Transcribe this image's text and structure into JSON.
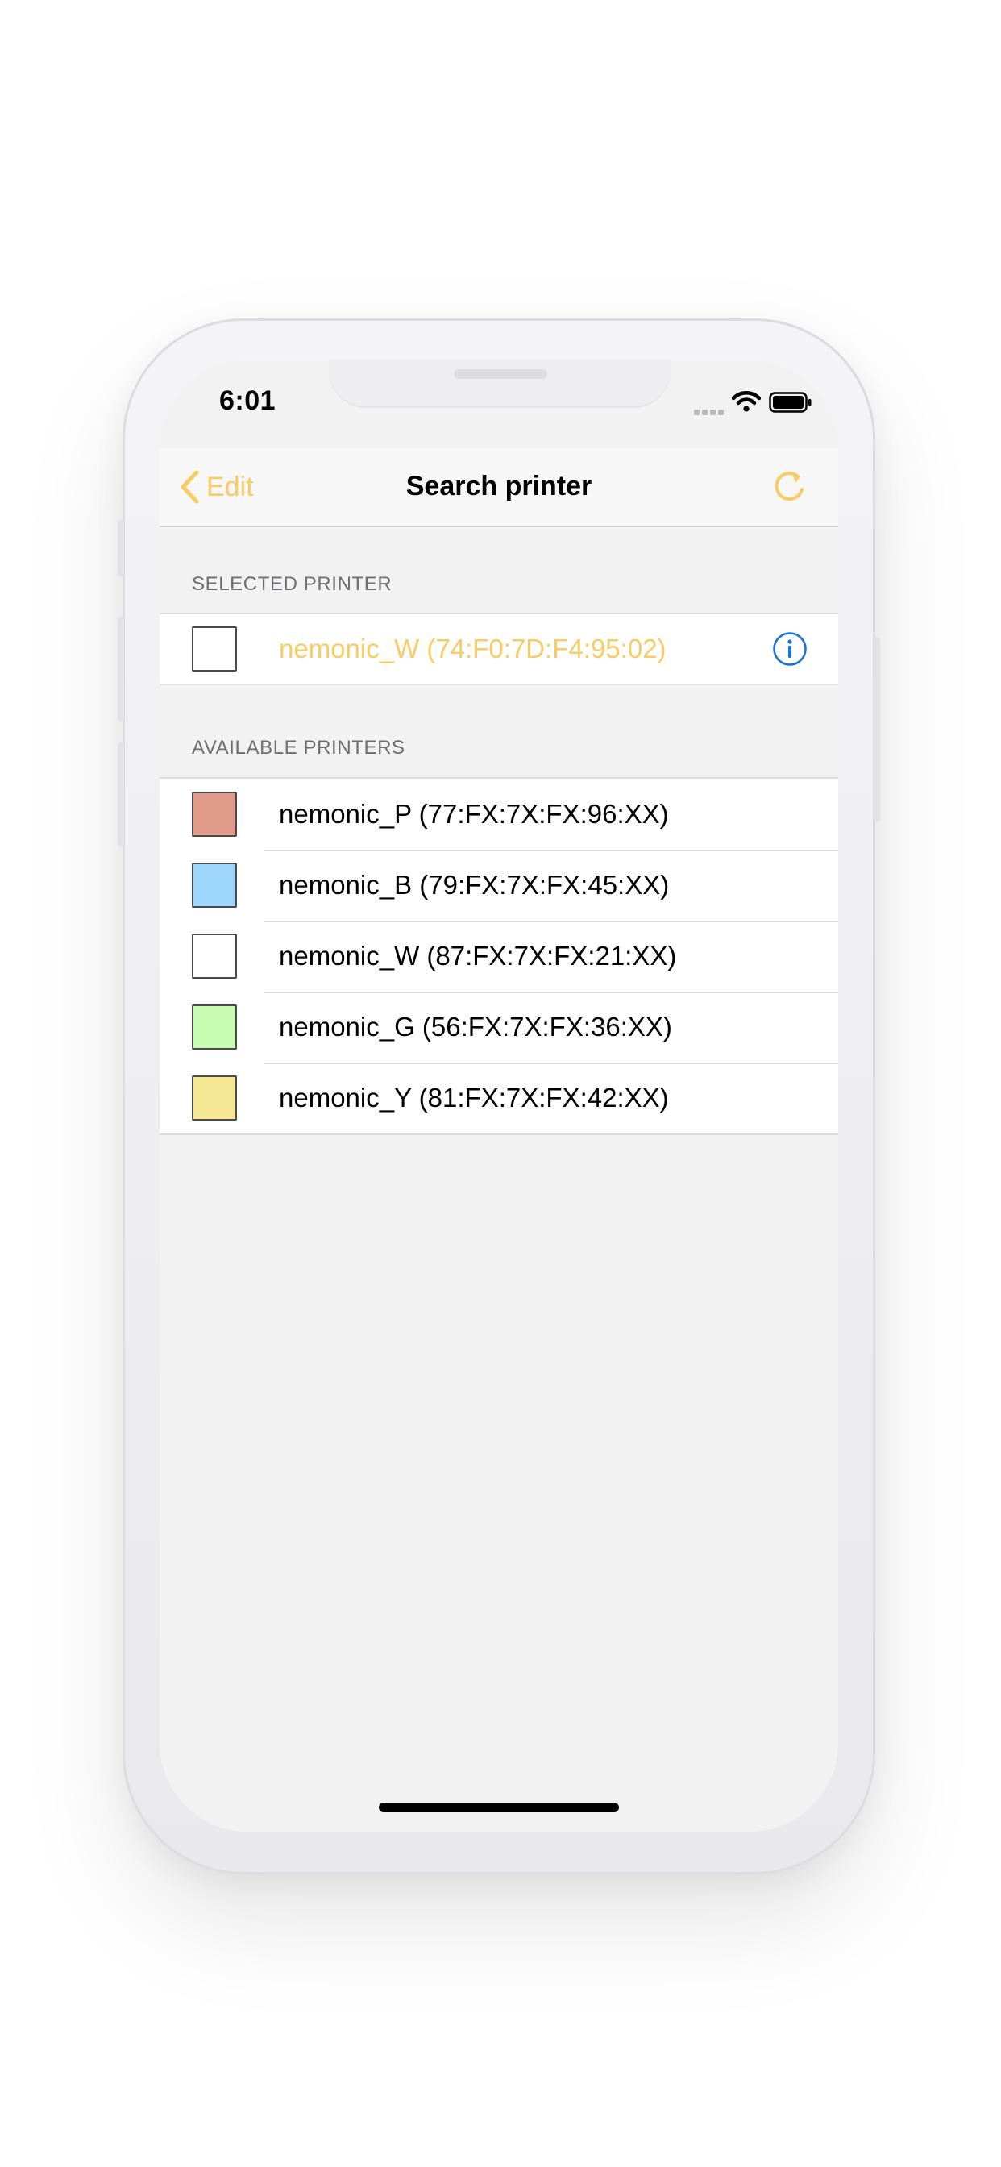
{
  "status_bar": {
    "time": "6:01"
  },
  "nav": {
    "back_label": "Edit",
    "title": "Search printer"
  },
  "sections": {
    "selected_header": "SELECTED PRINTER",
    "available_header": "AVAILABLE PRINTERS"
  },
  "selected_printer": {
    "label": "nemonic_W (74:F0:7D:F4:95:02)",
    "swatch_color": "#ffffff"
  },
  "available_printers": [
    {
      "label": "nemonic_P (77:FX:7X:FX:96:XX)",
      "swatch_color": "#e09a89"
    },
    {
      "label": "nemonic_B (79:FX:7X:FX:45:XX)",
      "swatch_color": "#9dd6fb"
    },
    {
      "label": "nemonic_W (87:FX:7X:FX:21:XX)",
      "swatch_color": "#ffffff"
    },
    {
      "label": "nemonic_G (56:FX:7X:FX:36:XX)",
      "swatch_color": "#c6fbb1"
    },
    {
      "label": "nemonic_Y (81:FX:7X:FX:42:XX)",
      "swatch_color": "#f6e795"
    }
  ],
  "colors": {
    "accent": "#f9cb63",
    "info_blue": "#1a73d9"
  },
  "icons": {
    "back": "chevron-left-icon",
    "refresh": "refresh-icon",
    "info": "info-icon"
  }
}
